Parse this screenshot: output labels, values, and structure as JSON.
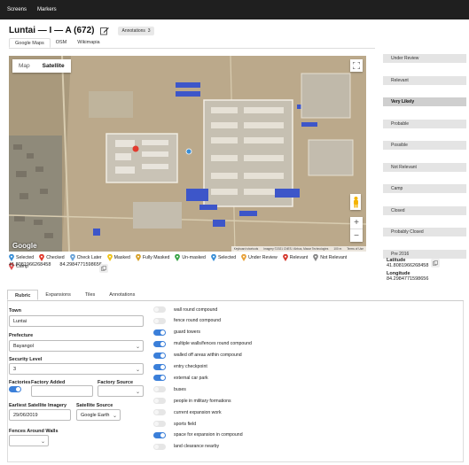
{
  "nav": {
    "items": [
      "Screens",
      "Markers"
    ]
  },
  "page": {
    "title": "Luntai — I — A (672)",
    "annotations_label": "Annotations",
    "annotations_count": "3"
  },
  "map_tabs": [
    "Google Maps",
    "OSM",
    "Wikimapia"
  ],
  "map": {
    "type_buttons": [
      "Map",
      "Satellite"
    ],
    "google_label": "Google",
    "attribution": [
      "Keyboard shortcuts",
      "Imagery ©2021 CNES / Airbus, Maxar Technologies",
      "100 m",
      "Terms of Use"
    ]
  },
  "legend": [
    {
      "label": "Selected",
      "color": "#3a8fd6"
    },
    {
      "label": "Checked",
      "color": "#e23a2e"
    },
    {
      "label": "Check Later",
      "color": "#6aa3d8"
    },
    {
      "label": "Masked",
      "color": "#f0c419"
    },
    {
      "label": "Fully Masked",
      "color": "#d8a22a"
    },
    {
      "label": "Un-masked",
      "color": "#3aa548"
    },
    {
      "label": "Selected",
      "color": "#3a8fd6"
    },
    {
      "label": "Under Review",
      "color": "#e8a23a"
    },
    {
      "label": "Relevant",
      "color": "#d63a2e"
    },
    {
      "label": "Not Relevant",
      "color": "#888888"
    },
    {
      "label": "Camp",
      "color": "#e05050"
    }
  ],
  "coords_left": {
    "lat": "41.8081966268458",
    "lng": "84.2984771598656"
  },
  "statuses": [
    {
      "label": "Under Review",
      "selected": false
    },
    {
      "label": "Relevant",
      "selected": false
    },
    {
      "label": "Very Likely",
      "selected": true
    },
    {
      "label": "Probable",
      "selected": false
    },
    {
      "label": "Possible",
      "selected": false
    },
    {
      "label": "Not Relevant",
      "selected": false
    },
    {
      "label": "Camp",
      "selected": false
    },
    {
      "label": "Closed",
      "selected": false
    },
    {
      "label": "Probably Closed",
      "selected": false
    },
    {
      "label": "Pre 2016",
      "selected": false
    }
  ],
  "latlng": {
    "lat_label": "Latitude",
    "lat": "41.8081966268458",
    "lng_label": "Longitude",
    "lng": "84.2984771598656"
  },
  "sub_tabs": [
    "Rubric",
    "Expansions",
    "Tiles",
    "Annotations"
  ],
  "form": {
    "town_label": "Town",
    "town": "Luntai",
    "prefecture_label": "Prefecture",
    "prefecture": "Bayangol",
    "security_label": "Security Level",
    "security": "3",
    "factories_label": "Factories",
    "factories_on": true,
    "factory_added_label": "Factory Added",
    "factory_source_label": "Factory Source",
    "earliest_label": "Earliest Satellite Imagery",
    "earliest": "29/06/2019",
    "sat_source_label": "Satellite Source",
    "sat_source": "Google Earth",
    "fences_label": "Fences Around Walls"
  },
  "checklist": [
    {
      "label": "wall round compound",
      "on": false
    },
    {
      "label": "fence round compound",
      "on": false
    },
    {
      "label": "guard towers",
      "on": true
    },
    {
      "label": "multiple walls/fences round compound",
      "on": true
    },
    {
      "label": "walled off areas within compound",
      "on": true
    },
    {
      "label": "entry checkpoint",
      "on": true
    },
    {
      "label": "external car park",
      "on": true
    },
    {
      "label": "buses",
      "on": false
    },
    {
      "label": "people in military formations",
      "on": false
    },
    {
      "label": "current expansion work",
      "on": false
    },
    {
      "label": "sports field",
      "on": false
    },
    {
      "label": "space for expansion in compound",
      "on": true
    },
    {
      "label": "land clearance nearby",
      "on": false
    }
  ]
}
